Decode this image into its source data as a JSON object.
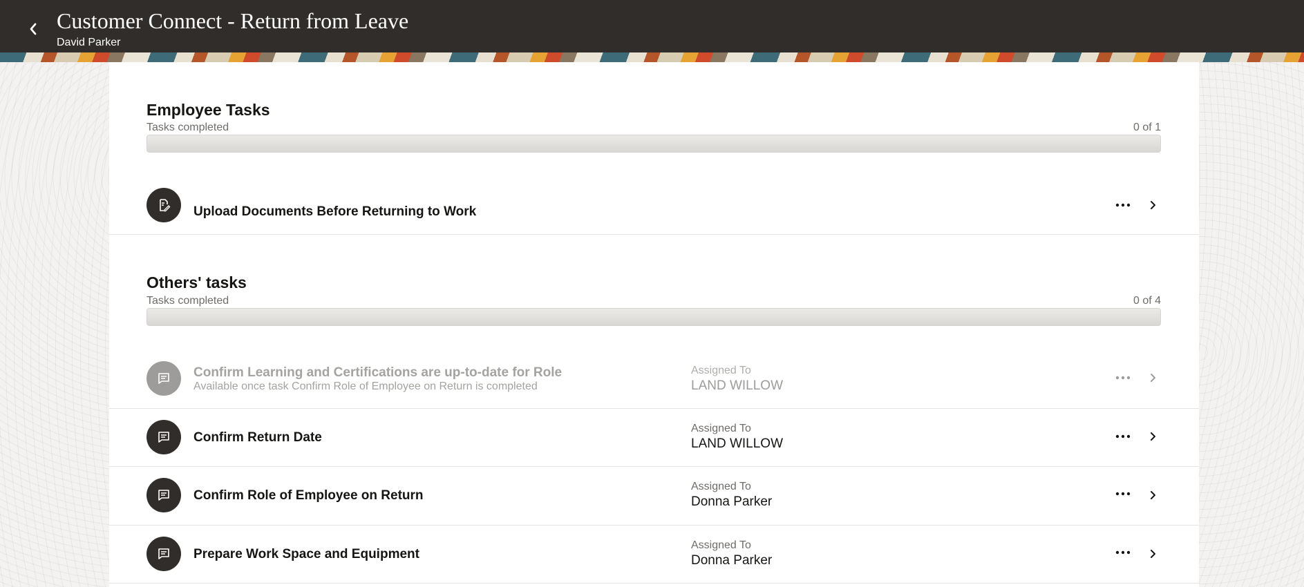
{
  "header": {
    "title": "Customer Connect - Return from Leave",
    "subtitle": "David Parker"
  },
  "employee_tasks": {
    "title": "Employee Tasks",
    "progress_label": "Tasks completed",
    "progress_count": "0 of 1",
    "progress_fraction": 0,
    "tasks": [
      {
        "title": "Upload Documents Before Returning to Work",
        "icon": "document-edit-icon"
      }
    ]
  },
  "others_tasks": {
    "title": "Others' tasks",
    "progress_label": "Tasks completed",
    "progress_count": "0 of 4",
    "progress_fraction": 0,
    "tasks": [
      {
        "title": "Confirm Learning and Certifications are up-to-date for Role",
        "note": "Available once task Confirm Role of Employee on Return is completed",
        "assigned_label": "Assigned To",
        "assigned_to": "LAND WILLOW",
        "disabled": true,
        "icon": "chat-icon"
      },
      {
        "title": "Confirm Return Date",
        "assigned_label": "Assigned To",
        "assigned_to": "LAND WILLOW",
        "icon": "chat-icon"
      },
      {
        "title": "Confirm Role of Employee on Return",
        "assigned_label": "Assigned To",
        "assigned_to": "Donna Parker",
        "icon": "chat-icon"
      },
      {
        "title": "Prepare Work Space and Equipment",
        "assigned_label": "Assigned To",
        "assigned_to": "Donna Parker",
        "icon": "chat-icon"
      }
    ]
  },
  "colors": {
    "header_bg": "#312d2a",
    "icon_bg": "#312d2a",
    "disabled_text": "#a5a3a0"
  }
}
